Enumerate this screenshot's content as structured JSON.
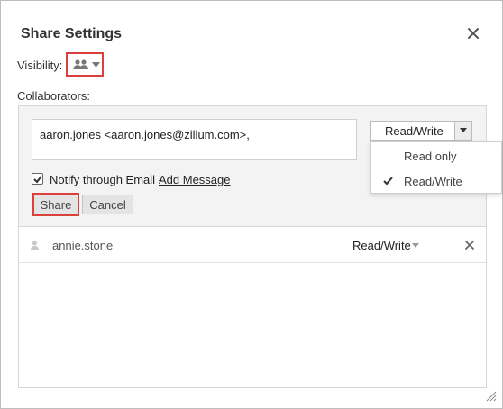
{
  "dialog": {
    "title": "Share Settings",
    "close_icon": "close-icon"
  },
  "visibility": {
    "label": "Visibility:",
    "icon": "group-icon",
    "caret_icon": "caret-down-icon"
  },
  "collaborators": {
    "label": "Collaborators:",
    "recipients_value": "aaron.jones <aaron.jones@zillum.com>,",
    "permission_selected": "Read/Write",
    "permission_options": [
      "Read only",
      "Read/Write"
    ]
  },
  "notify": {
    "checked": true,
    "label": "Notify through Email - ",
    "add_message_link": "Add Message"
  },
  "buttons": {
    "share": "Share",
    "cancel": "Cancel"
  },
  "shared_with": [
    {
      "name": "annie.stone",
      "permission": "Read/Write"
    }
  ],
  "colors": {
    "highlight": "#d9413a",
    "panel_bg": "#f3f3f3",
    "button_bg": "#e4e4e4"
  }
}
